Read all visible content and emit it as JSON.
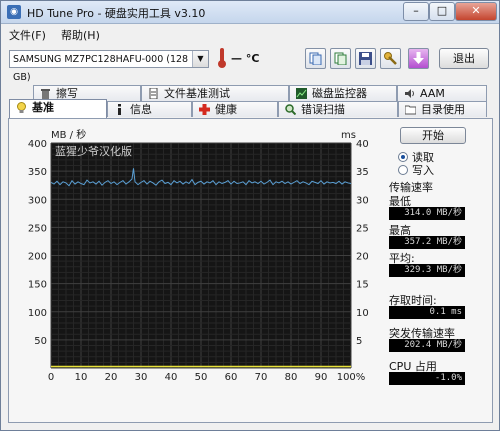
{
  "window": {
    "title": "HD Tune Pro - 硬盘实用工具 v3.10"
  },
  "menu": {
    "file": "文件(F)",
    "help": "帮助(H)"
  },
  "toolbar": {
    "drive": "SAMSUNG MZ7PC128HAFU-000 (128 GB)",
    "temperature": "— °C",
    "exit_label": "退出"
  },
  "tabs_top": [
    "擦写",
    "文件基准测试",
    "磁盘监控器",
    "AAM"
  ],
  "tabs_bottom": [
    "基准",
    "信息",
    "健康",
    "错误扫描",
    "目录使用"
  ],
  "chart_data": {
    "type": "line",
    "watermark": "蓝猩少爷汉化版",
    "left_axis_label": "MB / 秒",
    "right_axis_label": "ms",
    "y_left_ticks": [
      50,
      100,
      150,
      200,
      250,
      300,
      350,
      400
    ],
    "y_right_ticks": [
      5,
      10,
      15,
      20,
      25,
      30,
      35,
      40
    ],
    "x_ticks": [
      "0",
      "10",
      "20",
      "30",
      "40",
      "50",
      "60",
      "70",
      "80",
      "90",
      "100%"
    ],
    "ylim": [
      0,
      400
    ],
    "xlim": [
      0,
      100
    ],
    "series": [
      {
        "name": "传输速率",
        "color": "#5a9fd4",
        "x": [
          0,
          1,
          2,
          3,
          4,
          5,
          6,
          7,
          8,
          9,
          10,
          11,
          12,
          13,
          14,
          15,
          16,
          17,
          18,
          19,
          20,
          21,
          22,
          23,
          24,
          25,
          26,
          27,
          27.5,
          28,
          29,
          30,
          31,
          32,
          33,
          34,
          35,
          36,
          37,
          38,
          39,
          40,
          41,
          42,
          43,
          44,
          45,
          46,
          47,
          48,
          49,
          50,
          51,
          52,
          53,
          54,
          55,
          56,
          57,
          58,
          59,
          60,
          61,
          62,
          63,
          64,
          65,
          66,
          67,
          68,
          69,
          70,
          71,
          72,
          73,
          74,
          75,
          76,
          77,
          78,
          79,
          80,
          81,
          82,
          83,
          84,
          85,
          86,
          87,
          88,
          89,
          90,
          91,
          92,
          93,
          94,
          95,
          96,
          97,
          98,
          99,
          100
        ],
        "values": [
          330,
          327,
          332,
          326,
          331,
          329,
          324,
          333,
          327,
          331,
          328,
          326,
          334,
          329,
          331,
          327,
          332,
          325,
          330,
          333,
          328,
          331,
          326,
          330,
          333,
          327,
          331,
          336,
          355,
          331,
          326,
          330,
          333,
          327,
          332,
          329,
          325,
          331,
          334,
          328,
          330,
          326,
          333,
          329,
          332,
          327,
          331,
          328,
          335,
          326,
          330,
          332,
          327,
          331,
          329,
          333,
          326,
          331,
          328,
          330,
          333,
          327,
          332,
          328,
          329,
          331,
          326,
          333,
          329,
          331,
          328,
          332,
          327,
          330,
          334,
          326,
          331,
          329,
          332,
          328,
          331,
          327,
          330,
          333,
          328,
          331,
          329,
          326,
          332,
          330,
          328,
          333,
          327,
          331,
          329,
          330,
          328,
          332,
          327,
          331,
          329,
          328
        ]
      },
      {
        "name": "存取时间",
        "color": "#e8e23a",
        "x": [
          0,
          10,
          20,
          30,
          40,
          50,
          60,
          70,
          80,
          90,
          100
        ],
        "values": [
          0.1,
          0.1,
          0.1,
          0.1,
          0.1,
          0.1,
          0.1,
          0.1,
          0.1,
          0.1,
          0.1
        ]
      }
    ]
  },
  "controls": {
    "start_label": "开始",
    "read_label": "读取",
    "write_label": "写入",
    "transfer_title": "传输速率",
    "min_label": "最低",
    "min_value": "314.0 MB/秒",
    "max_label": "最高",
    "max_value": "357.2 MB/秒",
    "avg_label": "平均:",
    "avg_value": "329.3 MB/秒",
    "access_title": "存取时间:",
    "access_value": "0.1 ms",
    "burst_title": "突发传输速率",
    "burst_value": "202.4 MB/秒",
    "cpu_title": "CPU 占用",
    "cpu_value": "-1.0%"
  }
}
